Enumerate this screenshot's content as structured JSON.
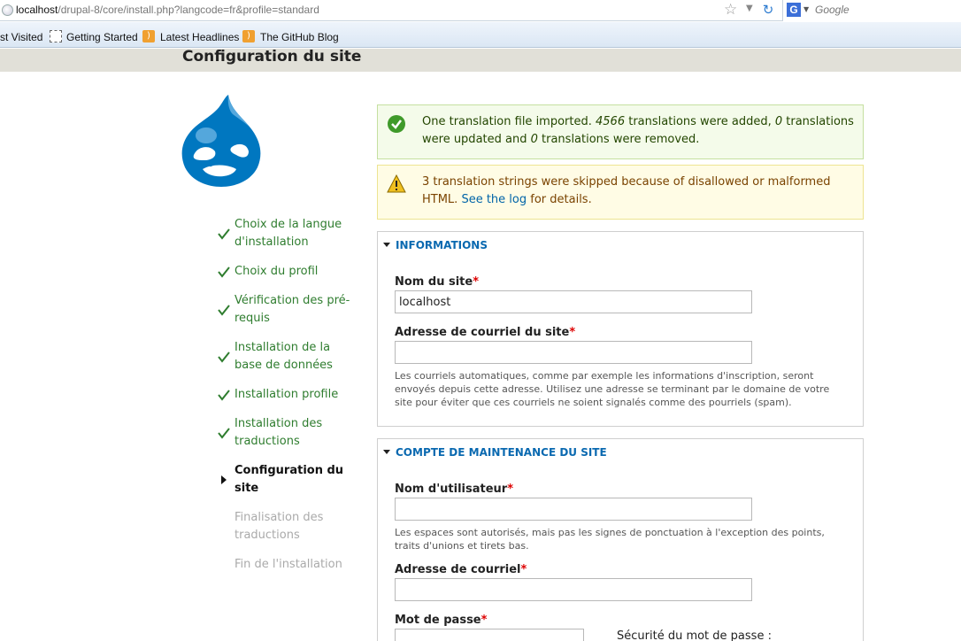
{
  "browser": {
    "url_host": "localhost",
    "url_path": "/drupal-8/core/install.php?langcode=fr&profile=standard",
    "search_engine": "G",
    "search_placeholder": "Google",
    "bookmarks": [
      {
        "label": "st Visited"
      },
      {
        "label": "Getting Started"
      },
      {
        "label": "Latest Headlines"
      },
      {
        "label": "The GitHub Blog"
      }
    ]
  },
  "page": {
    "title": "Configuration du site"
  },
  "tasks": [
    {
      "label": "Choix de la langue d'installation",
      "state": "done"
    },
    {
      "label": "Choix du profil",
      "state": "done"
    },
    {
      "label": "Vérification des pré-requis",
      "state": "done"
    },
    {
      "label": "Installation de la base de données",
      "state": "done"
    },
    {
      "label": "Installation profile",
      "state": "done"
    },
    {
      "label": "Installation des traductions",
      "state": "done"
    },
    {
      "label": "Configuration du site",
      "state": "active"
    },
    {
      "label": "Finalisation des traductions",
      "state": "pending"
    },
    {
      "label": "Fin de l'installation",
      "state": "pending"
    }
  ],
  "messages": {
    "status": {
      "part1": "One translation file imported. ",
      "added": "4566",
      "part2": " translations were added, ",
      "updated": "0",
      "part3": " translations were updated and ",
      "removed": "0",
      "part4": " translations were removed."
    },
    "warning": {
      "part1": "3 translation strings were skipped because of disallowed or malformed HTML. ",
      "link": "See the log",
      "part2": " for details."
    }
  },
  "informations": {
    "legend": "INFORMATIONS",
    "site_name_label": "Nom du site",
    "site_name_value": "localhost",
    "site_mail_label": "Adresse de courriel du site",
    "site_mail_value": "",
    "site_mail_desc": "Les courriels automatiques, comme par exemple les informations d'inscription, seront envoyés depuis cette adresse. Utilisez une adresse se terminant par le domaine de votre site pour éviter que ces courriels ne soient signalés comme des pourriels (spam)."
  },
  "maintenance": {
    "legend": "COMPTE DE MAINTENANCE DU SITE",
    "username_label": "Nom d'utilisateur",
    "username_value": "",
    "username_desc": "Les espaces sont autorisés, mais pas les signes de ponctuation à l'exception des points, traits d'unions et tirets bas.",
    "mail_label": "Adresse de courriel",
    "mail_value": "",
    "password_label": "Mot de passe",
    "password_strength_label": "Sécurité du mot de passe :"
  },
  "required_marker": "*",
  "icons": {
    "status": "check-circle-icon",
    "warning": "warning-triangle-icon",
    "task_done": "check-icon",
    "task_active": "arrow-right-icon",
    "logo": "drupal-drop-logo"
  },
  "colors": {
    "task_done": "#2f7d2f",
    "legend": "#0a69b0",
    "required": "#dd0000",
    "logo_blue": "#0077c0"
  }
}
